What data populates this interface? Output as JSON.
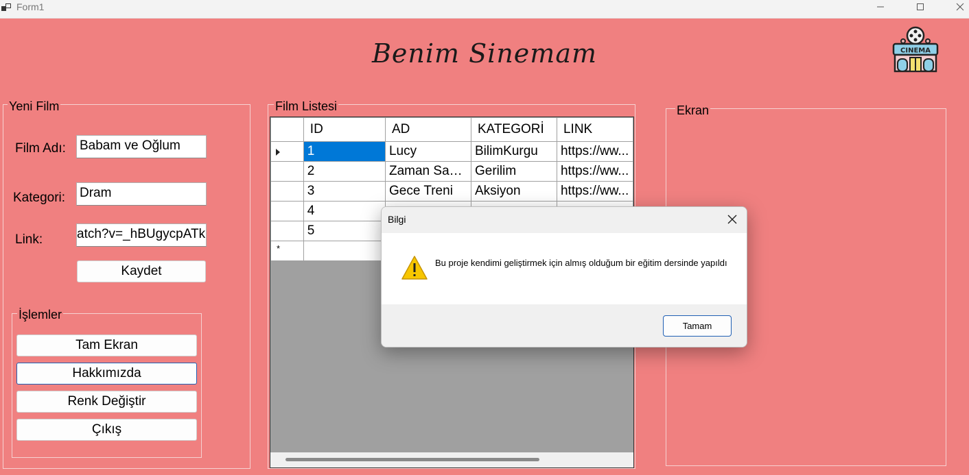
{
  "window": {
    "title": "Form1"
  },
  "header": {
    "title": "Benim Sinemam",
    "logo_text": "CINEMA"
  },
  "new_film": {
    "group_label": "Yeni Film",
    "name_label": "Film Adı:",
    "name_value": "Babam ve Oğlum",
    "category_label": "Kategori:",
    "category_value": "Dram",
    "link_label": "Link:",
    "link_value": "atch?v=_hBUgycpATk",
    "save_button": "Kaydet"
  },
  "operations": {
    "group_label": "İşlemler",
    "buttons": [
      "Tam Ekran",
      "Hakkımızda",
      "Renk Değiştir",
      "Çıkış"
    ]
  },
  "film_list": {
    "group_label": "Film Listesi",
    "columns": [
      "ID",
      "AD",
      "KATEGORİ",
      "LINK"
    ],
    "rows": [
      {
        "id": "1",
        "ad": "Lucy",
        "kategori": "BilimKurgu",
        "link": "https://ww..."
      },
      {
        "id": "2",
        "ad": "Zaman Sap...",
        "kategori": "Gerilim",
        "link": "https://ww..."
      },
      {
        "id": "3",
        "ad": "Gece Treni",
        "kategori": "Aksiyon",
        "link": "https://ww..."
      },
      {
        "id": "4",
        "ad": "",
        "kategori": "",
        "link": ""
      },
      {
        "id": "5",
        "ad": "",
        "kategori": "",
        "link": ""
      }
    ],
    "new_row_marker": "*"
  },
  "screen": {
    "group_label": "Ekran"
  },
  "dialog": {
    "title": "Bilgi",
    "message": "Bu proje kendimi geliştirmek için almış olduğum bir eğitim dersinde yapıldı",
    "ok_button": "Tamam",
    "icon": "warning-icon"
  },
  "colors": {
    "background": "#f08080",
    "selection": "#0078d7",
    "grid_empty": "#a0a0a0"
  }
}
